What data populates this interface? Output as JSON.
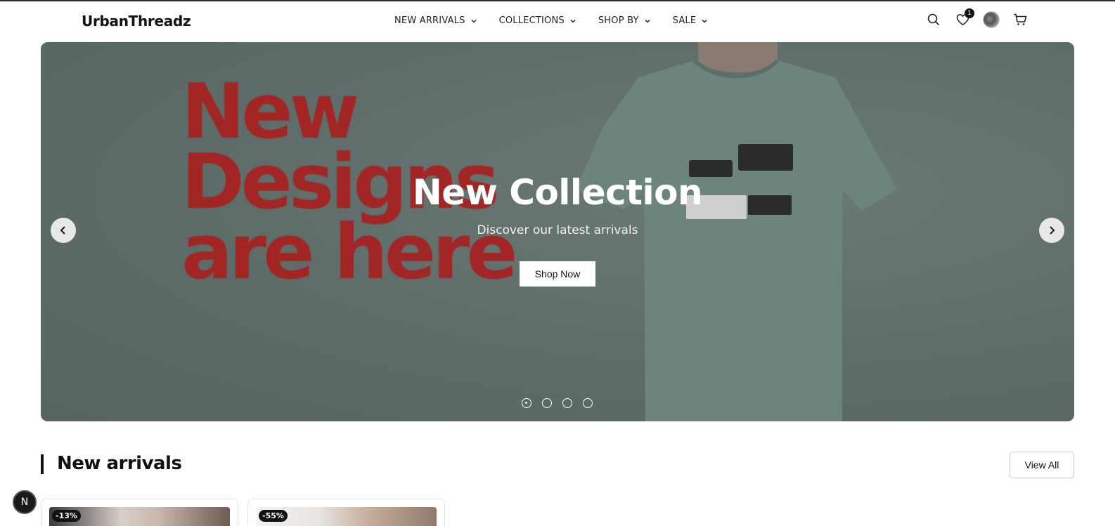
{
  "header": {
    "logo": "UrbanThreadz",
    "nav": [
      {
        "label": "NEW ARRIVALS"
      },
      {
        "label": "COLLECTIONS"
      },
      {
        "label": "SHOP BY"
      },
      {
        "label": "SALE"
      }
    ],
    "wishlist_count": "1",
    "icons": [
      "search-icon",
      "heart-icon",
      "avatar",
      "cart-icon"
    ]
  },
  "hero": {
    "image_text": "New Designs are here",
    "title": "New Collection",
    "subtitle": "Discover our latest arrivals",
    "cta_label": "Shop Now",
    "slide_count": 4,
    "active_slide": 1,
    "colors": {
      "background": "#5d6b69",
      "shirt": "#6d837d",
      "image_text": "#a8201f"
    }
  },
  "section": {
    "title": "New arrivals",
    "view_all_label": "View All",
    "products": [
      {
        "discount": "-13%"
      },
      {
        "discount": "-55%"
      }
    ]
  },
  "dev_badge": "N"
}
